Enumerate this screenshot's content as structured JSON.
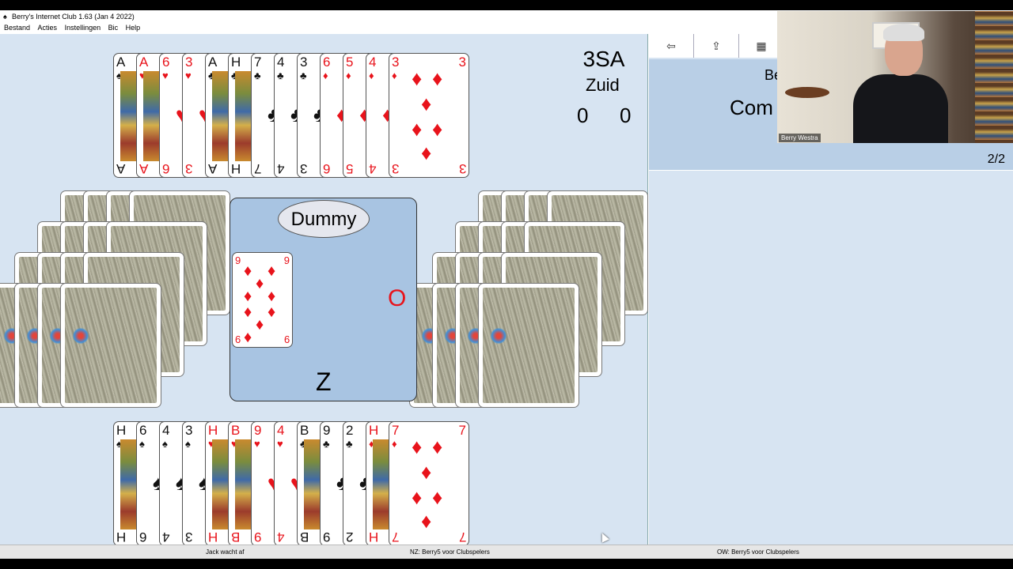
{
  "window": {
    "title": "Berry's Internet Club 1.63 (Jan  4 2022)"
  },
  "menu": {
    "items": [
      "Bestand",
      "Acties",
      "Instellingen",
      "Bic",
      "Help"
    ]
  },
  "game": {
    "contract": "3SA",
    "declarer": "Zuid",
    "score_ns": "0",
    "score_ew": "0",
    "center_label": "Dummy",
    "seat_east": "O",
    "seat_south": "Z",
    "trick_card": {
      "rank": "9",
      "suit": "diamond"
    }
  },
  "hands": {
    "north": [
      {
        "rank": "A",
        "suit": "spade",
        "court": true
      },
      {
        "rank": "A",
        "suit": "heart",
        "court": true
      },
      {
        "rank": "6",
        "suit": "heart"
      },
      {
        "rank": "3",
        "suit": "heart"
      },
      {
        "rank": "A",
        "suit": "club",
        "court": true
      },
      {
        "rank": "H",
        "suit": "club",
        "court": true
      },
      {
        "rank": "7",
        "suit": "club"
      },
      {
        "rank": "4",
        "suit": "club"
      },
      {
        "rank": "3",
        "suit": "club"
      },
      {
        "rank": "6",
        "suit": "diamond"
      },
      {
        "rank": "5",
        "suit": "diamond"
      },
      {
        "rank": "4",
        "suit": "diamond"
      },
      {
        "rank": "3",
        "suit": "diamond"
      }
    ],
    "south": [
      {
        "rank": "H",
        "suit": "spade",
        "court": true
      },
      {
        "rank": "6",
        "suit": "spade"
      },
      {
        "rank": "4",
        "suit": "spade"
      },
      {
        "rank": "3",
        "suit": "spade"
      },
      {
        "rank": "H",
        "suit": "heart",
        "court": true
      },
      {
        "rank": "B",
        "suit": "heart",
        "court": true
      },
      {
        "rank": "9",
        "suit": "heart"
      },
      {
        "rank": "4",
        "suit": "heart"
      },
      {
        "rank": "B",
        "suit": "club",
        "court": true
      },
      {
        "rank": "9",
        "suit": "club"
      },
      {
        "rank": "2",
        "suit": "club"
      },
      {
        "rank": "H",
        "suit": "diamond",
        "court": true
      },
      {
        "rank": "7",
        "suit": "diamond"
      }
    ]
  },
  "right_panel": {
    "toolbar": [
      {
        "icon": "arrow-left-icon",
        "glyph": "⇦"
      },
      {
        "icon": "share-icon",
        "glyph": "⇪"
      },
      {
        "icon": "grid-icon",
        "glyph": "▦"
      }
    ],
    "info_line1": "Be",
    "info_line2": "Com",
    "page": "2/2"
  },
  "webcam": {
    "name": "Berry Westra"
  },
  "status": {
    "left": "Jack wacht af",
    "center": "NZ: Berry5 voor Clubspelers",
    "right": "OW: Berry5 voor Clubspelers"
  },
  "colors": {
    "table_bg": "#d7e4f2",
    "center_box": "#a8c4e2",
    "red_suit": "#e8131b"
  }
}
